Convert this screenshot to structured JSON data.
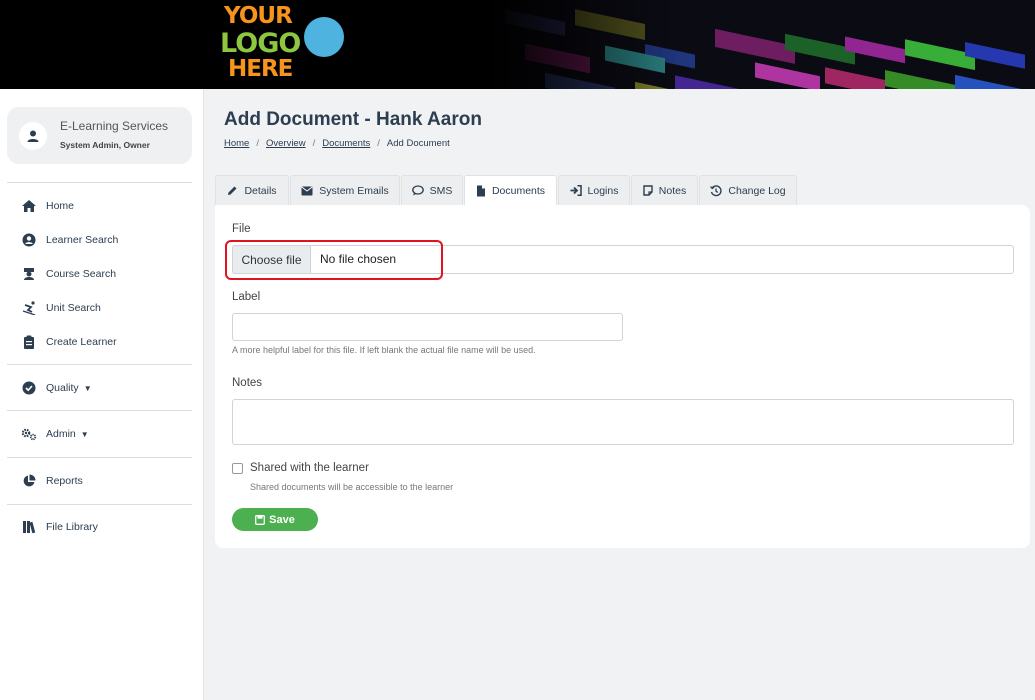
{
  "logo": {
    "line1": "YOUR",
    "line2": "LOGO",
    "line3": "HERE"
  },
  "user": {
    "name": "E-Learning Services",
    "role": "System Admin, Owner"
  },
  "sidebar": {
    "items": [
      {
        "label": "Home",
        "icon": "home-icon"
      },
      {
        "label": "Learner Search",
        "icon": "user-circle-icon"
      },
      {
        "label": "Course Search",
        "icon": "graduation-icon"
      },
      {
        "label": "Unit Search",
        "icon": "skiing-icon"
      },
      {
        "label": "Create Learner",
        "icon": "clipboard-icon"
      },
      {
        "label": "Quality",
        "icon": "check-circle-icon"
      },
      {
        "label": "Admin",
        "icon": "gears-icon"
      },
      {
        "label": "Reports",
        "icon": "pie-chart-icon"
      },
      {
        "label": "File Library",
        "icon": "books-icon"
      }
    ]
  },
  "page": {
    "title": "Add Document - Hank Aaron",
    "breadcrumb": [
      "Home",
      "Overview",
      "Documents",
      "Add Document"
    ]
  },
  "tabs": [
    {
      "label": "Details",
      "icon": "pencil-icon"
    },
    {
      "label": "System Emails",
      "icon": "envelope-icon"
    },
    {
      "label": "SMS",
      "icon": "comment-icon"
    },
    {
      "label": "Documents",
      "icon": "file-icon"
    },
    {
      "label": "Logins",
      "icon": "sign-in-icon"
    },
    {
      "label": "Notes",
      "icon": "note-icon"
    },
    {
      "label": "Change Log",
      "icon": "history-icon"
    }
  ],
  "active_tab": "Documents",
  "form": {
    "file_label": "File",
    "choose_file": "Choose file",
    "no_file": "No file chosen",
    "label_label": "Label",
    "label_value": "",
    "label_help": "A more helpful label for this file. If left blank the actual file name will be used.",
    "notes_label": "Notes",
    "notes_value": "",
    "shared_label": "Shared with the learner",
    "shared_checked": false,
    "shared_help": "Shared documents will be accessible to the learner",
    "save_label": "Save"
  },
  "colors": {
    "accent": "#4caf50",
    "highlight": "#e0131e",
    "text": "#2c3e50"
  }
}
